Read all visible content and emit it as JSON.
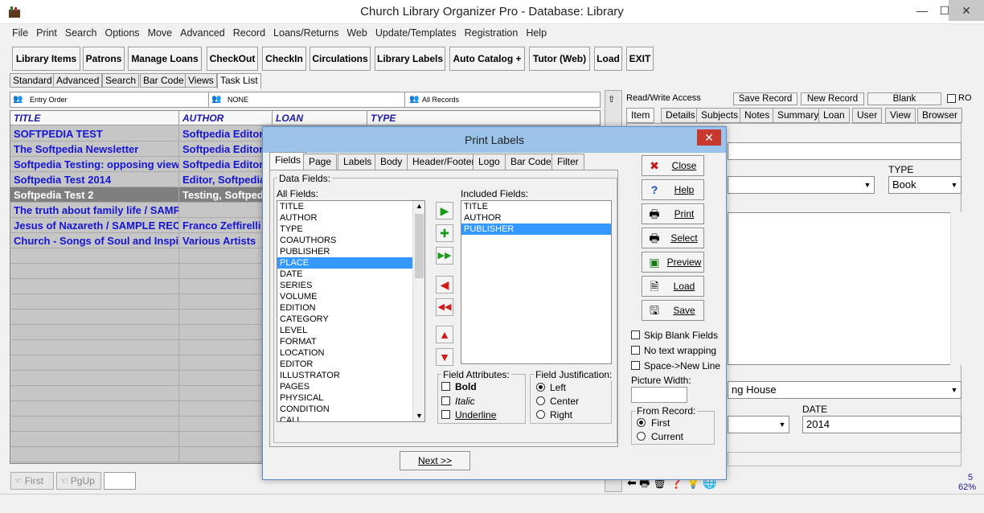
{
  "window": {
    "title": "Church Library Organizer Pro - Database: Library",
    "minimize": "—",
    "maximize": "☐",
    "close": "✕"
  },
  "menu": [
    "File",
    "Print",
    "Search",
    "Options",
    "Move",
    "Advanced",
    "Record",
    "Loans/Returns",
    "Web",
    "Update/Templates",
    "Registration",
    "Help"
  ],
  "toolbar": [
    "Library Items",
    "Patrons",
    "Manage Loans",
    "CheckOut",
    "CheckIn",
    "Circulations",
    "Library Labels",
    "Auto Catalog +",
    "Tutor (Web)",
    "Load",
    "EXIT"
  ],
  "view_tabs": [
    "Standard",
    "Advanced",
    "Search",
    "Bar Code",
    "Views",
    "Task List"
  ],
  "filter_bar": {
    "order": "Entry Order",
    "filter": "NONE",
    "records": "All Records"
  },
  "grid": {
    "columns": [
      "TITLE",
      "AUTHOR",
      "LOAN",
      "TYPE"
    ],
    "rows": [
      {
        "title": "SOFTPEDIA TEST",
        "author": "Softpedia Editor"
      },
      {
        "title": "The Softpedia Newsletter",
        "author": "Softpedia Editor"
      },
      {
        "title": "Softpedia Testing: opposing views",
        "author": "Softpedia Editor"
      },
      {
        "title": "Softpedia Test 2014",
        "author": "Editor, Softpedia"
      },
      {
        "title": "Softpedia Test 2",
        "author": "Testing, Softpedia"
      },
      {
        "title": "The truth about family life / SAMPLE",
        "author": ""
      },
      {
        "title": "Jesus of Nazareth / SAMPLE RECORD",
        "author": "Franco Zeffirelli"
      },
      {
        "title": "Church - Songs of Soul and Inspiration",
        "author": "Various Artists"
      }
    ],
    "selected_row": 4
  },
  "nav": {
    "first": "First",
    "pgup": "PgUp"
  },
  "right_panel": {
    "access": "Read/Write Access",
    "save": "Save Record",
    "new": "New Record",
    "blank": "Blank",
    "ro": "RO",
    "tabs": [
      "Item",
      "Details",
      "Subjects",
      "Notes",
      "Summary",
      "Loan",
      "User",
      "View",
      "Browser"
    ],
    "type_label": "TYPE",
    "type_value": "Book",
    "publisher_value": "ng House",
    "date_label": "DATE",
    "date_value": "2014",
    "status_count": "5",
    "status_pct": "62%"
  },
  "dialog": {
    "title": "Print Labels",
    "tabs": [
      "Fields",
      "Page",
      "Labels",
      "Body",
      "Header/Footer",
      "Logo",
      "Bar Code",
      "Filter"
    ],
    "data_fields_label": "Data Fields:",
    "all_fields_label": "All Fields:",
    "all_fields": [
      "TITLE",
      "AUTHOR",
      "TYPE",
      "COAUTHORS",
      "PUBLISHER",
      "PLACE",
      "DATE",
      "SERIES",
      "VOLUME",
      "EDITION",
      "CATEGORY",
      "LEVEL",
      "FORMAT",
      "LOCATION",
      "EDITOR",
      "ILLUSTRATOR",
      "PAGES",
      "PHYSICAL",
      "CONDITION",
      "CALL"
    ],
    "all_selected": 5,
    "included_label": "Included Fields:",
    "included_fields": [
      "TITLE",
      "AUTHOR",
      "PUBLISHER"
    ],
    "included_selected": 2,
    "attributes": {
      "label": "Field Attributes:",
      "bold": "Bold",
      "italic": "Italic",
      "underline": "Underline"
    },
    "justification": {
      "label": "Field Justification:",
      "left": "Left",
      "center": "Center",
      "right": "Right"
    },
    "buttons": {
      "close": "Close",
      "help": "Help",
      "print": "Print",
      "select": "Select",
      "preview": "Preview",
      "load": "Load",
      "save": "Save"
    },
    "options": {
      "skip_blank": "Skip Blank Fields",
      "no_wrap": "No text wrapping",
      "space_newline": "Space->New Line"
    },
    "picture_width_label": "Picture Width:",
    "from_record": {
      "label": "From Record:",
      "first": "First",
      "current": "Current"
    },
    "next": "Next >>"
  },
  "colors": {
    "link_blue": "#1515d6",
    "dialog_title": "#9cc4ea",
    "selection": "#3399ff"
  }
}
